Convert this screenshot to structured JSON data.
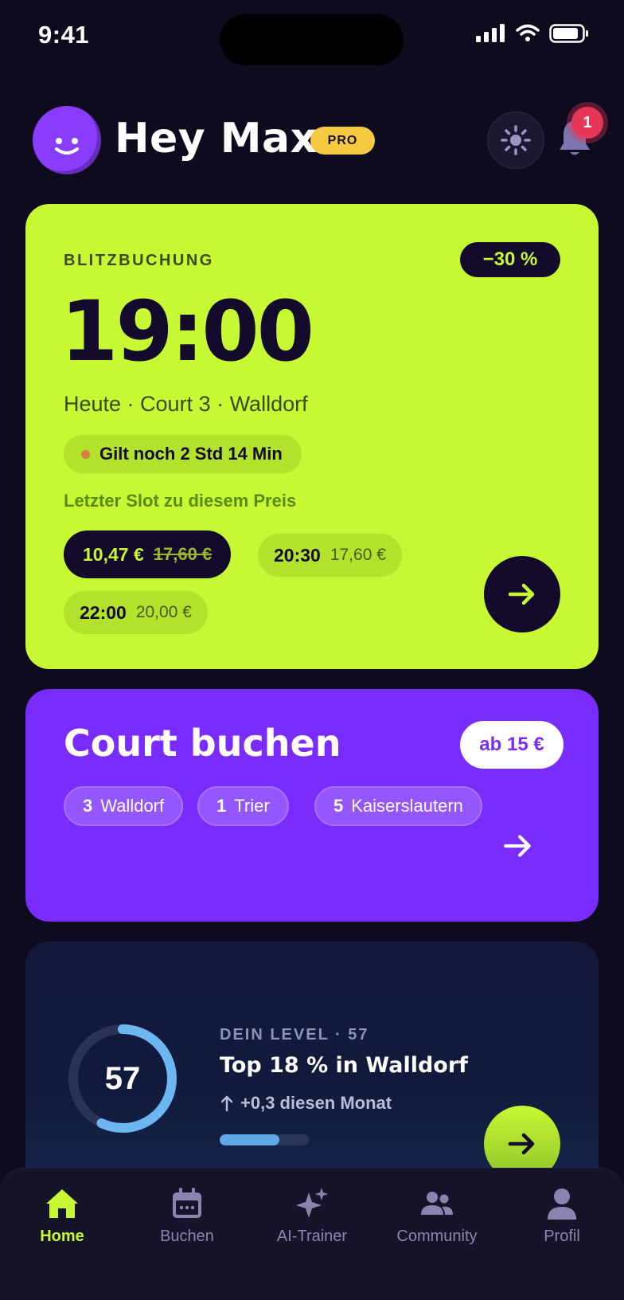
{
  "status": {
    "time": "9:41"
  },
  "header": {
    "greeting": "Hey Max",
    "badge": "PRO",
    "notifications_count": "1"
  },
  "blitz": {
    "label": "BLITZBUCHUNG",
    "discount": "−30 %",
    "time": "19:00",
    "subtitle": "Heute · Court 3 · Walldorf",
    "validity": "Gilt noch 2 Std 14 Min",
    "last_slot_note": "Letzter Slot zu diesem Preis",
    "slots": [
      {
        "time": "10,47 €",
        "price": "17,60 €",
        "selected": true
      },
      {
        "time": "20:30",
        "price": "17,60 €",
        "selected": false
      },
      {
        "time": "22:00",
        "price": "20,00 €",
        "selected": false
      }
    ]
  },
  "court": {
    "title": "Court buchen",
    "price_from": "ab 15 €",
    "locations": [
      {
        "count": "3",
        "name": "Walldorf"
      },
      {
        "count": "1",
        "name": "Trier"
      },
      {
        "count": "5",
        "name": "Kaiserslautern"
      }
    ]
  },
  "level": {
    "label": "DEIN LEVEL · 57",
    "value": "57",
    "progress_fraction": 0.57,
    "title": "Top 18 % in Walldorf",
    "trend": "+0,3 diesen Monat",
    "bar_fraction": 0.67
  },
  "tabs": [
    {
      "label": "Home",
      "icon": "home-icon",
      "active": true
    },
    {
      "label": "Buchen",
      "icon": "calendar-icon",
      "active": false
    },
    {
      "label": "AI-Trainer",
      "icon": "sparkle-icon",
      "active": false
    },
    {
      "label": "Community",
      "icon": "people-icon",
      "active": false
    },
    {
      "label": "Profil",
      "icon": "person-icon",
      "active": false
    }
  ],
  "colors": {
    "accent_lime": "#c6f833",
    "accent_purple": "#7a2cff",
    "background": "#0e0b1f",
    "pro_badge": "#f5c940",
    "notification": "#e63758"
  }
}
